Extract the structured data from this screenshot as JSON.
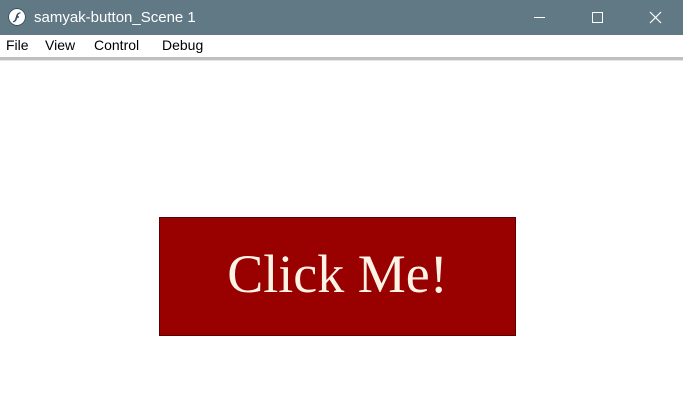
{
  "window": {
    "title": "samyak-button_Scene 1"
  },
  "titlebar": {
    "app_icon": "flash-player-icon",
    "minimize_icon": "minimize-icon",
    "maximize_icon": "maximize-icon",
    "close_icon": "close-icon",
    "background_color": "#607985"
  },
  "menu": {
    "items": [
      {
        "label": "File"
      },
      {
        "label": "View"
      },
      {
        "label": "Control"
      },
      {
        "label": "Debug"
      }
    ]
  },
  "stage": {
    "button": {
      "label": "Click Me!",
      "background_color": "#990000",
      "text_color": "#fff3e6"
    }
  }
}
